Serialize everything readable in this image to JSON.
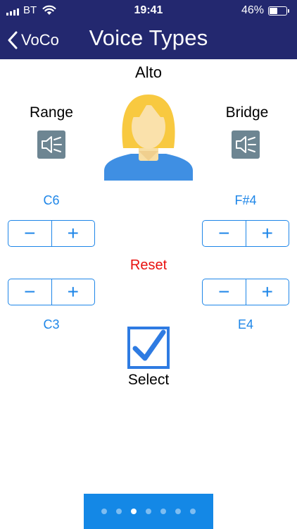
{
  "status_bar": {
    "carrier": "BT",
    "time": "19:41",
    "battery_percent": "46%"
  },
  "nav": {
    "back_label": "VoCo",
    "title": "Voice Types"
  },
  "voice": {
    "name": "Alto",
    "range_label": "Range",
    "bridge_label": "Bridge",
    "range_high": "C6",
    "range_low": "C3",
    "bridge_high": "F#4",
    "bridge_low": "E4"
  },
  "stepper": {
    "minus": "−",
    "plus": "+"
  },
  "reset_label": "Reset",
  "select": {
    "label": "Select",
    "checked": true
  },
  "pager": {
    "pages": 7,
    "current_page": 3
  },
  "colors": {
    "nav_background": "#23286f",
    "accent_blue": "#1e86e8",
    "reset_red": "#e8100e",
    "speaker_button": "#6d8592",
    "pager_background": "#1488e6"
  }
}
